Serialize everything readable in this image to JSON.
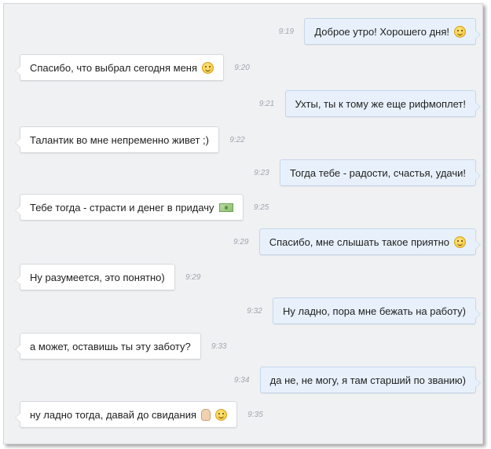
{
  "messages": [
    {
      "dir": "out",
      "text": "Доброе утро! Хорошего дня!",
      "time": "9:19",
      "icons": [
        "wink-smiley-icon"
      ]
    },
    {
      "dir": "in",
      "text": "Спасибо, что выбрал сегодня меня",
      "time": "9:20",
      "icons": [
        "wink-smiley-icon"
      ]
    },
    {
      "dir": "out",
      "text": "Ухты, ты к тому же еще рифмоплет!",
      "time": "9:21",
      "icons": []
    },
    {
      "dir": "in",
      "text": "Талантик во мне непременно живет ;)",
      "time": "9:22",
      "icons": []
    },
    {
      "dir": "out",
      "text": "Тогда тебе - радости, счастья, удачи!",
      "time": "9:23",
      "icons": []
    },
    {
      "dir": "in",
      "text": "Тебе тогда - страсти и денег в придачу",
      "time": "9:25",
      "icons": [
        "money-icon"
      ]
    },
    {
      "dir": "out",
      "text": "Спасибо, мне слышать такое приятно",
      "time": "9:29",
      "icons": [
        "smiley-icon"
      ]
    },
    {
      "dir": "in",
      "text": "Ну разумеется, это понятно)",
      "time": "9:29",
      "icons": []
    },
    {
      "dir": "out",
      "text": "Ну ладно, пора мне бежать на работу)",
      "time": "9:32",
      "icons": []
    },
    {
      "dir": "in",
      "text": "а может, оставишь ты эту заботу?",
      "time": "9:33",
      "icons": []
    },
    {
      "dir": "out",
      "text": "да не, не могу, я там старший по званию)",
      "time": "9:34",
      "icons": []
    },
    {
      "dir": "in",
      "text": "ну ладно тогда, давай до свидания",
      "time": "9:35",
      "icons": [
        "waving-hand-icon",
        "grin-smiley-icon"
      ]
    }
  ],
  "colors": {
    "background": "#f0f1f3",
    "incoming_bubble": "#ffffff",
    "outgoing_bubble": "#e8f1fb",
    "outgoing_border": "#c4d6ea",
    "timestamp": "#9ea6b0"
  }
}
